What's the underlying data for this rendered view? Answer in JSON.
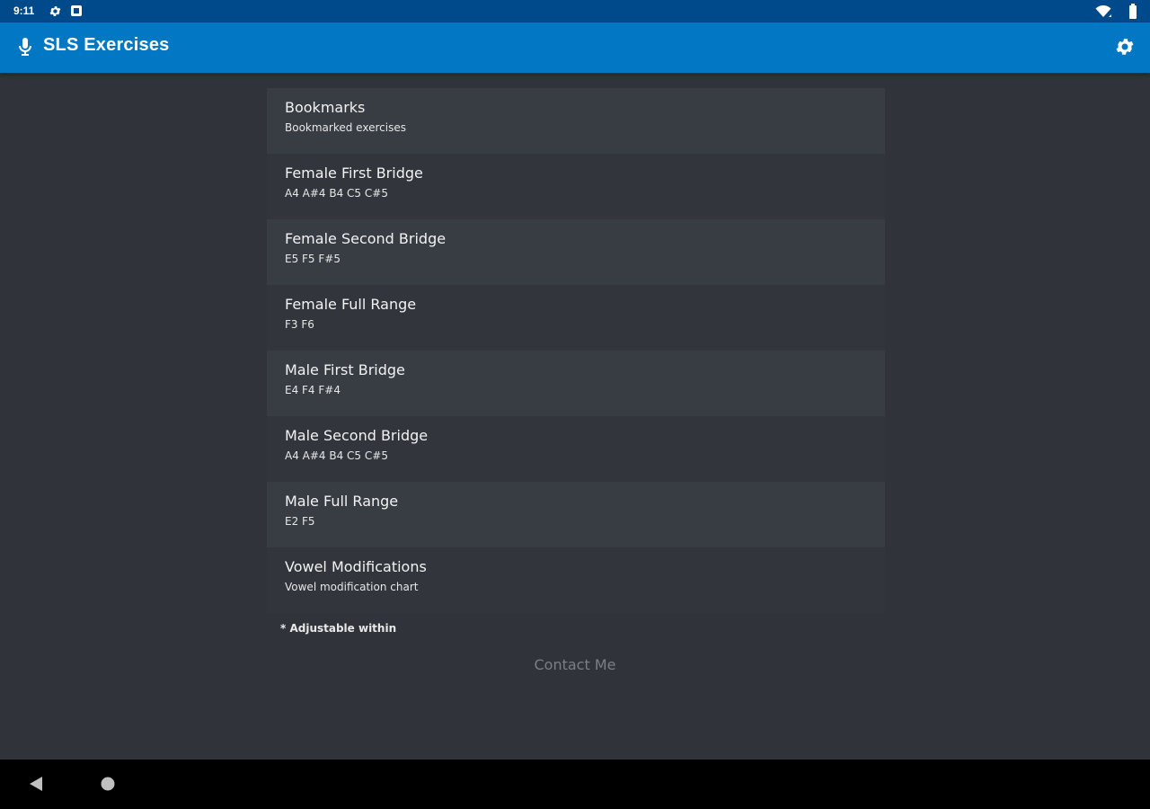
{
  "status_bar": {
    "time": "9:11",
    "icons": [
      "settings-icon",
      "notification-box-icon",
      "wifi-icon",
      "signal-icon",
      "battery-icon"
    ]
  },
  "app_bar": {
    "title": "SLS Exercises",
    "leading_icon": "mic-icon",
    "trailing_icon": "settings-gear-icon"
  },
  "list": {
    "items": [
      {
        "title": "Bookmarks",
        "subtitle": "Bookmarked exercises"
      },
      {
        "title": "Female First Bridge",
        "subtitle": "A4 A#4 B4 C5 C#5"
      },
      {
        "title": "Female Second Bridge",
        "subtitle": "E5 F5 F#5"
      },
      {
        "title": "Female Full Range",
        "subtitle": "F3 F6"
      },
      {
        "title": "Male First Bridge",
        "subtitle": "E4 F4 F#4"
      },
      {
        "title": "Male Second Bridge",
        "subtitle": "A4 A#4 B4 C5 C#5"
      },
      {
        "title": "Male Full Range",
        "subtitle": "E2 F5"
      },
      {
        "title": "Vowel Modifications",
        "subtitle": "Vowel modification chart"
      }
    ]
  },
  "footnote": "* Adjustable within",
  "contact_label": "Contact Me",
  "nav_bar": {
    "icons": [
      "back-icon",
      "home-icon"
    ]
  },
  "colors": {
    "status_bar": "#00498a",
    "app_bar": "#0277c4",
    "background": "#30343a",
    "list_item_light": "#383d44",
    "list_item_dark": "#32363c",
    "contact_text": "#7a7f86"
  }
}
